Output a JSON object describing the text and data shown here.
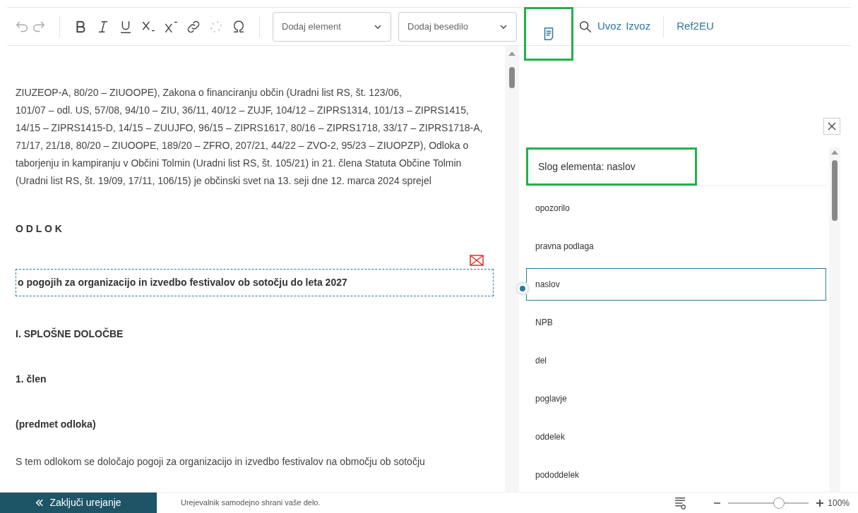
{
  "toolbar": {
    "element_dropdown": {
      "placeholder": "Dodaj element"
    },
    "text_dropdown": {
      "placeholder": "Dodaj besedilo"
    },
    "links": [
      "Uvoz",
      "Izvoz"
    ],
    "ref_link": "Ref2EU"
  },
  "document": {
    "paragraphs": [
      {
        "kind": "body",
        "text": "ZIUZEOP-A, 80/20 – ZIUOOPE), Zakona o financiranju občin (Uradni list RS, št. 123/06,"
      },
      {
        "kind": "body",
        "text": "101/07 – odl. US, 57/08, 94/10 – ZIU, 36/11, 40/12 – ZUJF, 104/12 – ZIPRS1314, 101/13 – ZIPRS1415, 14/15 – ZIPRS1415-D, 14/15 – ZUUJFO, 96/15 – ZIPRS1617, 80/16 – ZIPRS1718, 33/17 – ZIPRS1718-A, 71/17, 21/18, 80/20 – ZIUOOPE, 189/20 – ZFRO, 207/21, 44/22 – ZVO-2, 95/23 – ZIUOPZP), Odloka o taborjenju in kampiranju v Občini Tolmin (Uradni list RS, št. 105/21) in 21. člena Statuta Občine Tolmin (Uradni list RS, št. 19/09, 17/11, 106/15) je občinski svet na 13. seji dne 12. marca 2024 sprejel"
      },
      {
        "kind": "spaced",
        "text": "O D L O K"
      },
      {
        "kind": "selected",
        "text": "o pogojih za organizacijo in izvedbo festivalov ob sotočju do leta 2027"
      },
      {
        "kind": "heading",
        "text": "I. SPLOŠNE DOLOČBE"
      },
      {
        "kind": "heading",
        "text": "1. člen"
      },
      {
        "kind": "heading",
        "text": "(predmet odloka)"
      },
      {
        "kind": "body",
        "text": "S tem odlokom se določajo pogoji za organizacijo in izvedbo festivalov na območju ob sotočju"
      }
    ]
  },
  "style_panel": {
    "title": "Slog elementa: naslov",
    "items": [
      {
        "label": "opozorilo",
        "selected": false
      },
      {
        "label": "pravna podlaga",
        "selected": false
      },
      {
        "label": "naslov",
        "selected": true
      },
      {
        "label": "NPB",
        "selected": false
      },
      {
        "label": "del",
        "selected": false
      },
      {
        "label": "poglavje",
        "selected": false
      },
      {
        "label": "oddelek",
        "selected": false
      },
      {
        "label": "pododdelek",
        "selected": false
      }
    ]
  },
  "footer": {
    "button": "Zaključi urejanje",
    "note": "Urejevalnik samodejno shrani vaše delo.",
    "zoom": {
      "level": 0.63,
      "reading": "100%"
    }
  }
}
